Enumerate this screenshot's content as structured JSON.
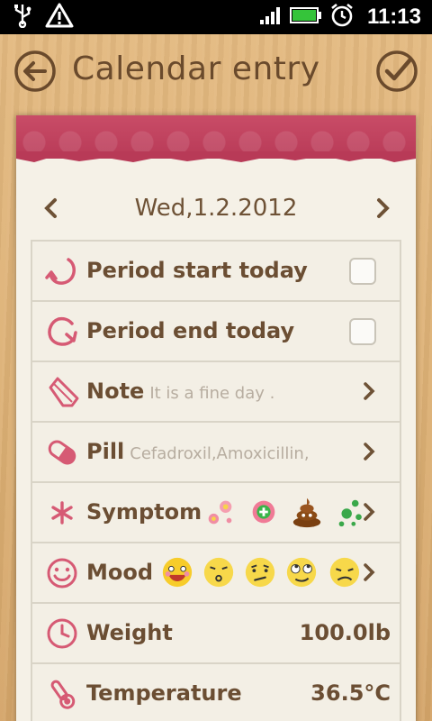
{
  "status_bar": {
    "time": "11:13",
    "icons": [
      "usb-icon",
      "warning-icon",
      "signal-icon",
      "battery-icon",
      "alarm-icon"
    ]
  },
  "header": {
    "title": "Calendar entry",
    "back_icon": "back-arrow-icon",
    "done_icon": "checkmark-icon"
  },
  "date_nav": {
    "date": "Wed,1.2.2012",
    "prev_icon": "chevron-left-icon",
    "next_icon": "chevron-right-icon"
  },
  "entries": {
    "period_start": {
      "label": "Period start today",
      "checked": false
    },
    "period_end": {
      "label": "Period end today",
      "checked": false
    },
    "note": {
      "label": "Note",
      "value": "It is a fine day ."
    },
    "pill": {
      "label": "Pill",
      "value": "Cefadroxil,Amoxicillin,"
    },
    "symptom": {
      "label": "Symptom",
      "icons": [
        "flower-symptom-icon",
        "plus-badge-icon",
        "poop-icon",
        "sneeze-icon"
      ]
    },
    "mood": {
      "label": "Mood",
      "icons": [
        "laughing-face-icon",
        "kissing-face-icon",
        "confused-face-icon",
        "eye-roll-face-icon",
        "tired-face-icon"
      ]
    },
    "weight": {
      "label": "Weight",
      "value": "100.0lb"
    },
    "temperature": {
      "label": "Temperature",
      "value": "36.5°C"
    }
  },
  "colors": {
    "accent": "#d65a74",
    "text_brown": "#6b4e33",
    "paper": "#f5f1e7",
    "ribbon": "#c44a65"
  }
}
